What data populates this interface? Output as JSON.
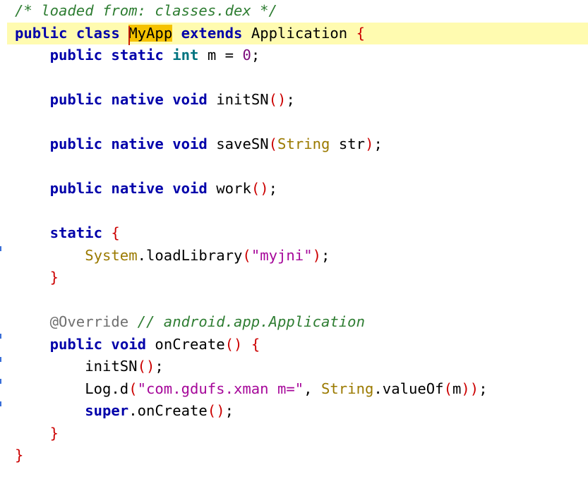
{
  "editor": {
    "lines": [
      {
        "tokens": [
          {
            "t": "/* loaded from: classes.dex */",
            "c": "comment"
          }
        ]
      },
      {
        "current": true,
        "tokens": [
          {
            "t": "public",
            "c": "kw"
          },
          {
            "t": " ",
            "c": "plain"
          },
          {
            "t": "class",
            "c": "kw"
          },
          {
            "t": " ",
            "c": "plain"
          },
          {
            "t": "MyApp",
            "c": "sel"
          },
          {
            "t": " ",
            "c": "plain"
          },
          {
            "t": "extends",
            "c": "kw"
          },
          {
            "t": " Application ",
            "c": "plain"
          },
          {
            "t": "{",
            "c": "paren"
          }
        ]
      },
      {
        "tokens": [
          {
            "t": "    ",
            "c": "plain"
          },
          {
            "t": "public",
            "c": "kw"
          },
          {
            "t": " ",
            "c": "plain"
          },
          {
            "t": "static",
            "c": "kw"
          },
          {
            "t": " ",
            "c": "plain"
          },
          {
            "t": "int",
            "c": "type"
          },
          {
            "t": " m = ",
            "c": "plain"
          },
          {
            "t": "0",
            "c": "num"
          },
          {
            "t": ";",
            "c": "plain"
          }
        ]
      },
      {
        "tokens": []
      },
      {
        "tokens": [
          {
            "t": "    ",
            "c": "plain"
          },
          {
            "t": "public",
            "c": "kw"
          },
          {
            "t": " ",
            "c": "plain"
          },
          {
            "t": "native",
            "c": "kw"
          },
          {
            "t": " ",
            "c": "plain"
          },
          {
            "t": "void",
            "c": "kw"
          },
          {
            "t": " initSN",
            "c": "plain"
          },
          {
            "t": "()",
            "c": "paren"
          },
          {
            "t": ";",
            "c": "plain"
          }
        ]
      },
      {
        "tokens": []
      },
      {
        "tokens": [
          {
            "t": "    ",
            "c": "plain"
          },
          {
            "t": "public",
            "c": "kw"
          },
          {
            "t": " ",
            "c": "plain"
          },
          {
            "t": "native",
            "c": "kw"
          },
          {
            "t": " ",
            "c": "plain"
          },
          {
            "t": "void",
            "c": "kw"
          },
          {
            "t": " saveSN",
            "c": "plain"
          },
          {
            "t": "(",
            "c": "paren"
          },
          {
            "t": "String",
            "c": "cls"
          },
          {
            "t": " str",
            "c": "plain"
          },
          {
            "t": ")",
            "c": "paren"
          },
          {
            "t": ";",
            "c": "plain"
          }
        ]
      },
      {
        "tokens": []
      },
      {
        "tokens": [
          {
            "t": "    ",
            "c": "plain"
          },
          {
            "t": "public",
            "c": "kw"
          },
          {
            "t": " ",
            "c": "plain"
          },
          {
            "t": "native",
            "c": "kw"
          },
          {
            "t": " ",
            "c": "plain"
          },
          {
            "t": "void",
            "c": "kw"
          },
          {
            "t": " work",
            "c": "plain"
          },
          {
            "t": "()",
            "c": "paren"
          },
          {
            "t": ";",
            "c": "plain"
          }
        ]
      },
      {
        "tokens": []
      },
      {
        "tokens": [
          {
            "t": "    ",
            "c": "plain"
          },
          {
            "t": "static",
            "c": "kw"
          },
          {
            "t": " ",
            "c": "plain"
          },
          {
            "t": "{",
            "c": "paren"
          }
        ]
      },
      {
        "tokens": [
          {
            "t": "        ",
            "c": "plain"
          },
          {
            "t": "System",
            "c": "cls"
          },
          {
            "t": ".loadLibrary",
            "c": "plain"
          },
          {
            "t": "(",
            "c": "paren"
          },
          {
            "t": "\"myjni\"",
            "c": "str"
          },
          {
            "t": ")",
            "c": "paren"
          },
          {
            "t": ";",
            "c": "plain"
          }
        ]
      },
      {
        "tokens": [
          {
            "t": "    ",
            "c": "plain"
          },
          {
            "t": "}",
            "c": "paren"
          }
        ]
      },
      {
        "tokens": []
      },
      {
        "tokens": [
          {
            "t": "    ",
            "c": "plain"
          },
          {
            "t": "@Override",
            "c": "ann"
          },
          {
            "t": " ",
            "c": "plain"
          },
          {
            "t": "// android.app.Application",
            "c": "comment"
          }
        ]
      },
      {
        "tokens": [
          {
            "t": "    ",
            "c": "plain"
          },
          {
            "t": "public",
            "c": "kw"
          },
          {
            "t": " ",
            "c": "plain"
          },
          {
            "t": "void",
            "c": "kw"
          },
          {
            "t": " onCreate",
            "c": "plain"
          },
          {
            "t": "()",
            "c": "paren"
          },
          {
            "t": " ",
            "c": "plain"
          },
          {
            "t": "{",
            "c": "paren"
          }
        ]
      },
      {
        "tokens": [
          {
            "t": "        initSN",
            "c": "plain"
          },
          {
            "t": "()",
            "c": "paren"
          },
          {
            "t": ";",
            "c": "plain"
          }
        ]
      },
      {
        "tokens": [
          {
            "t": "        Log.d",
            "c": "plain"
          },
          {
            "t": "(",
            "c": "paren"
          },
          {
            "t": "\"com.gdufs.xman m=\"",
            "c": "str"
          },
          {
            "t": ", ",
            "c": "plain"
          },
          {
            "t": "String",
            "c": "cls"
          },
          {
            "t": ".valueOf",
            "c": "plain"
          },
          {
            "t": "(",
            "c": "paren"
          },
          {
            "t": "m",
            "c": "plain"
          },
          {
            "t": "))",
            "c": "paren"
          },
          {
            "t": ";",
            "c": "plain"
          }
        ]
      },
      {
        "tokens": [
          {
            "t": "        ",
            "c": "plain"
          },
          {
            "t": "super",
            "c": "kw"
          },
          {
            "t": ".onCreate",
            "c": "plain"
          },
          {
            "t": "()",
            "c": "paren"
          },
          {
            "t": ";",
            "c": "plain"
          }
        ]
      },
      {
        "tokens": [
          {
            "t": "    ",
            "c": "plain"
          },
          {
            "t": "}",
            "c": "paren"
          }
        ]
      },
      {
        "tokens": [
          {
            "t": "}",
            "c": "paren"
          }
        ]
      }
    ],
    "colors": {
      "keyword": "#0000aa",
      "type": "#007480",
      "class": "#9b7a00",
      "string": "#a6089a",
      "number": "#7a0a7a",
      "comment": "#2e7d32",
      "annotation": "#707070",
      "bracket": "#cc0000",
      "current_line": "#fffbb0",
      "selection": "#f5c200",
      "gutter_marker": "#3a6fd8"
    }
  }
}
